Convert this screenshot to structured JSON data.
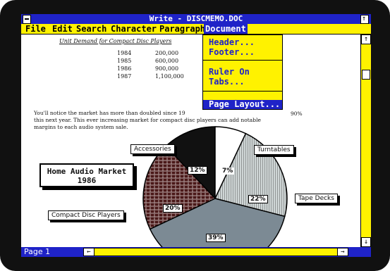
{
  "window": {
    "title": "Write - DISCMEMO.DOC"
  },
  "menubar": {
    "items": [
      "File",
      "Edit",
      "Search",
      "Character",
      "Paragraph",
      "Document"
    ],
    "active": "Document"
  },
  "document_menu": {
    "items": [
      "Header...",
      "Footer...",
      "Ruler On",
      "Tabs...",
      "Page Layout..."
    ],
    "selected": "Page Layout..."
  },
  "doc": {
    "heading": "Unit Demand for Compact Disc Players",
    "years": [
      "1984",
      "1985",
      "1986",
      "1987"
    ],
    "sales": [
      "200,000",
      "600,000",
      "900,000",
      "1,100,000"
    ],
    "paragraph_lines": [
      "You'll notice the market has more than doubled since 19",
      "this next year. This ever increasing market for compact disc players can add notable",
      "margins to each audio system sale."
    ],
    "paragraph_tail": "90%"
  },
  "chart_data": {
    "type": "pie",
    "title": "Home Audio Market 1986",
    "categories": [
      "Accessories",
      "Turntables",
      "Tape Decks",
      "Compact Disc Players"
    ],
    "slice_labels": [
      "12%",
      "7%",
      "22%",
      "39%",
      "20%"
    ],
    "values": [
      12,
      7,
      22,
      39,
      20
    ]
  },
  "status": {
    "page": "Page 1"
  },
  "colors": {
    "title_bar": "#1f23c8",
    "menu_bar": "#fff200",
    "menu_text": "#1f23c8"
  }
}
